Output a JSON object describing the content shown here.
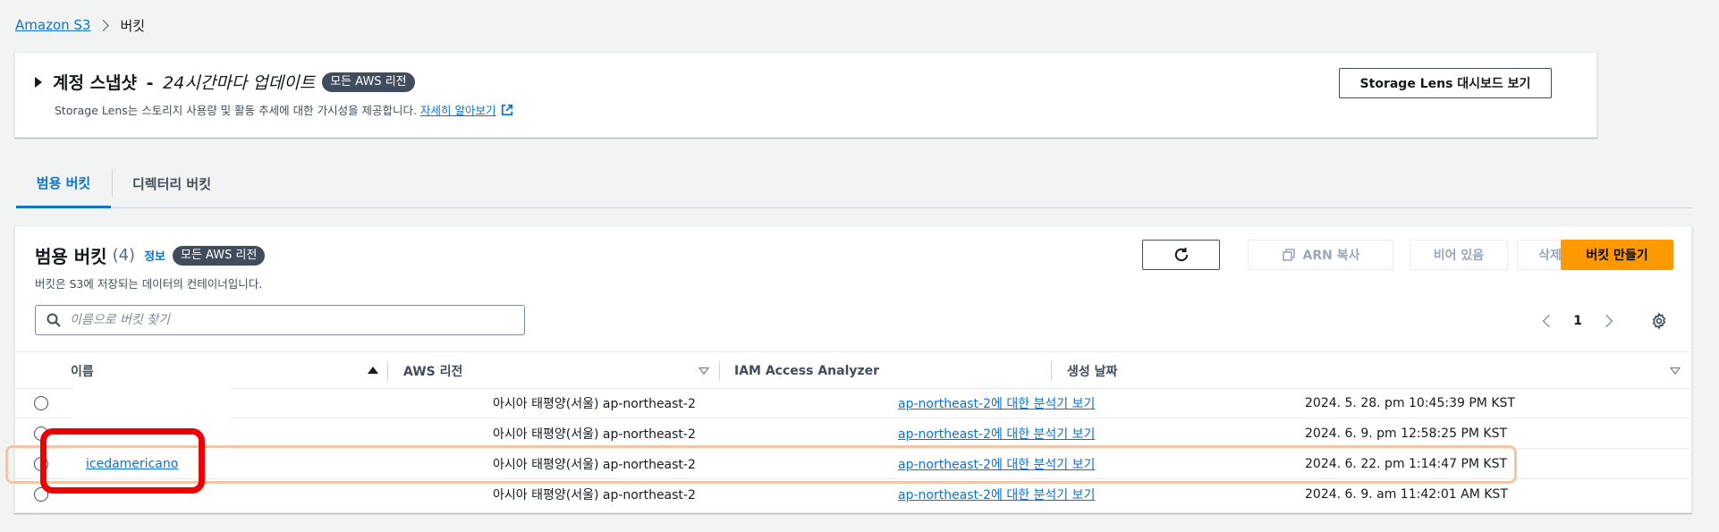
{
  "breadcrumb": {
    "root": "Amazon S3",
    "current": "버킷"
  },
  "storage_lens": {
    "title_main": "계정 스냅샷",
    "title_dash": "-",
    "title_sub": "24시간마다 업데이트",
    "badge": "모든 AWS 리전",
    "description": "Storage Lens는 스토리지 사용량 및 활동 추세에 대한 가시성을 제공합니다.",
    "learn_more": "자세히 알아보기",
    "dashboard_button": "Storage Lens 대시보드 보기"
  },
  "tabs": [
    {
      "label": "범용 버킷",
      "active": true
    },
    {
      "label": "디렉터리 버킷",
      "active": false
    }
  ],
  "buckets_panel": {
    "title": "범용 버킷",
    "count": "(4)",
    "info": "정보",
    "badge": "모든 AWS 리전",
    "description": "버킷은 S3에 저장되는 데이터의 컨테이너입니다.",
    "search_placeholder": "이름으로 버킷 찾기",
    "actions": {
      "copy_arn": "ARN 복사",
      "empty": "비어 있음",
      "delete": "삭제",
      "create": "버킷 만들기"
    },
    "page": "1"
  },
  "table": {
    "columns": [
      "이름",
      "AWS 리전",
      "IAM Access Analyzer",
      "생성 날짜"
    ],
    "rows": [
      {
        "name": "",
        "region": "아시아 태평양(서울) ap-northeast-2",
        "iam": "ap-northeast-2에 대한 분석기 보기",
        "created": "2024. 5. 28. pm 10:45:39 PM KST"
      },
      {
        "name": "",
        "region": "아시아 태평양(서울) ap-northeast-2",
        "iam": "ap-northeast-2에 대한 분석기 보기",
        "created": "2024. 6. 9. pm 12:58:25 PM KST"
      },
      {
        "name": "icedamericano",
        "region": "아시아 태평양(서울) ap-northeast-2",
        "iam": "ap-northeast-2에 대한 분석기 보기",
        "created": "2024. 6. 22. pm 1:14:47 PM KST"
      },
      {
        "name": "",
        "region": "아시아 태평양(서울) ap-northeast-2",
        "iam": "ap-northeast-2에 대한 분석기 보기",
        "created": "2024. 6. 9. am 11:42:01 AM KST"
      }
    ]
  },
  "colors": {
    "link": "#0972d3",
    "primary_button": "#ff9900",
    "badge_bg": "#414d5c",
    "highlight_red": "#ee0000",
    "highlight_orange": "#f2c4a8"
  },
  "icons": [
    "caret-right-icon",
    "external-link-icon",
    "refresh-icon",
    "copy-icon",
    "search-icon",
    "chevron-left-icon",
    "chevron-right-icon",
    "settings-icon",
    "sort-ascending-icon",
    "sort-icon"
  ]
}
